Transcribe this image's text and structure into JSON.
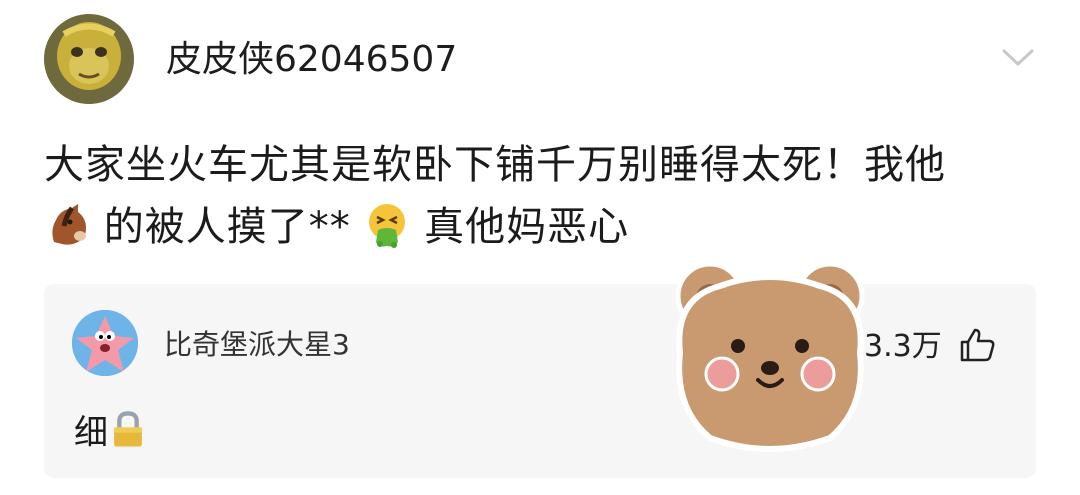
{
  "post": {
    "username": "皮皮侠62046507",
    "text_part1": "大家坐火车尤其是软卧下铺千万别睡得太死！我他",
    "text_part2": "的被人摸了**",
    "text_part3": "真他妈恶心",
    "emojis": [
      "horse-face",
      "vomiting-face"
    ]
  },
  "reply": {
    "username": "比奇堡派大星3",
    "text": "细",
    "emoji": "lock",
    "likes": "3.3万"
  },
  "icons": {
    "chevron": "chevron-down-icon",
    "like": "thumbs-up-icon"
  },
  "sticker": "bear-sticker"
}
